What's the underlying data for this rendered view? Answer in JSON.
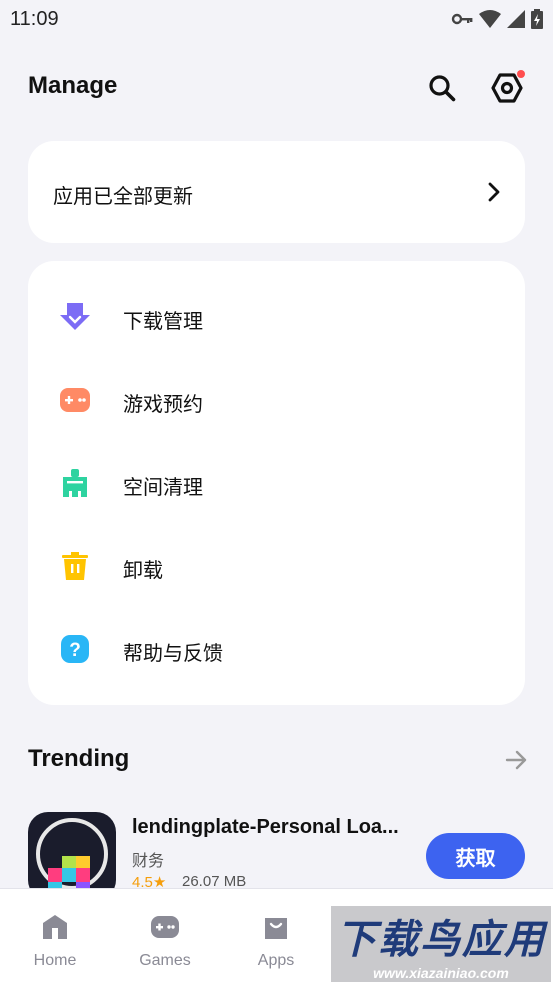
{
  "status": {
    "time": "11:09"
  },
  "header": {
    "title": "Manage"
  },
  "update_card": {
    "text": "应用已全部更新"
  },
  "menu": {
    "items": [
      {
        "label": "下载管理",
        "icon": "download-icon",
        "color": "#7c6cf5"
      },
      {
        "label": "游戏预约",
        "icon": "gamepad-icon",
        "color": "#ff8a65"
      },
      {
        "label": "空间清理",
        "icon": "broom-icon",
        "color": "#2ed3a0"
      },
      {
        "label": "卸载",
        "icon": "trash-icon",
        "color": "#ffc400"
      },
      {
        "label": "帮助与反馈",
        "icon": "help-icon",
        "color": "#29b6f6"
      }
    ]
  },
  "trending": {
    "title": "Trending",
    "app": {
      "name": "lendingplate-Personal Loa...",
      "category": "财务",
      "rating": "4.5★",
      "size": "26.07 MB",
      "button": "获取"
    }
  },
  "nav": {
    "items": [
      {
        "label": "Home"
      },
      {
        "label": "Games"
      },
      {
        "label": "Apps"
      }
    ]
  },
  "watermark": {
    "main": "下载鸟应用",
    "sub": "www.xiazainiao.com"
  },
  "colors": {
    "accent": "#3d63f0",
    "notification": "#ff4d4f",
    "background": "#f3f3f8"
  }
}
